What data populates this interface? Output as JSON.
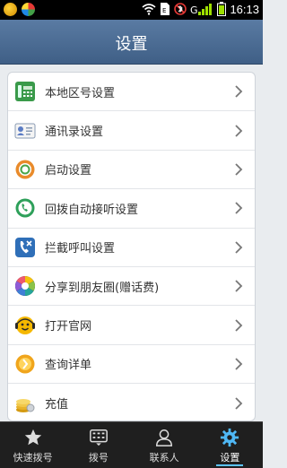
{
  "status_bar": {
    "time": "16:13"
  },
  "header": {
    "title": "设置"
  },
  "settings": [
    {
      "label": "本地区号设置",
      "icon": "phone-icon"
    },
    {
      "label": "通讯录设置",
      "icon": "contacts-card-icon"
    },
    {
      "label": "启动设置",
      "icon": "power-ring-icon"
    },
    {
      "label": "回拨自动接听设置",
      "icon": "callback-icon"
    },
    {
      "label": "拦截呼叫设置",
      "icon": "intercept-call-icon"
    },
    {
      "label": "分享到朋友圈(赠话费)",
      "icon": "moments-share-icon"
    },
    {
      "label": "打开官网",
      "icon": "mascot-icon"
    },
    {
      "label": "查询详单",
      "icon": "query-bill-icon"
    },
    {
      "label": "充值",
      "icon": "coins-icon"
    }
  ],
  "bottom_nav": [
    {
      "label": "快速拨号",
      "icon": "star-icon",
      "active": false
    },
    {
      "label": "拨号",
      "icon": "dialpad-icon",
      "active": false
    },
    {
      "label": "联系人",
      "icon": "person-icon",
      "active": false
    },
    {
      "label": "设置",
      "icon": "gear-icon",
      "active": true
    }
  ],
  "colors": {
    "header_blue": "#4a6a92",
    "active_accent": "#5cc3ff"
  }
}
